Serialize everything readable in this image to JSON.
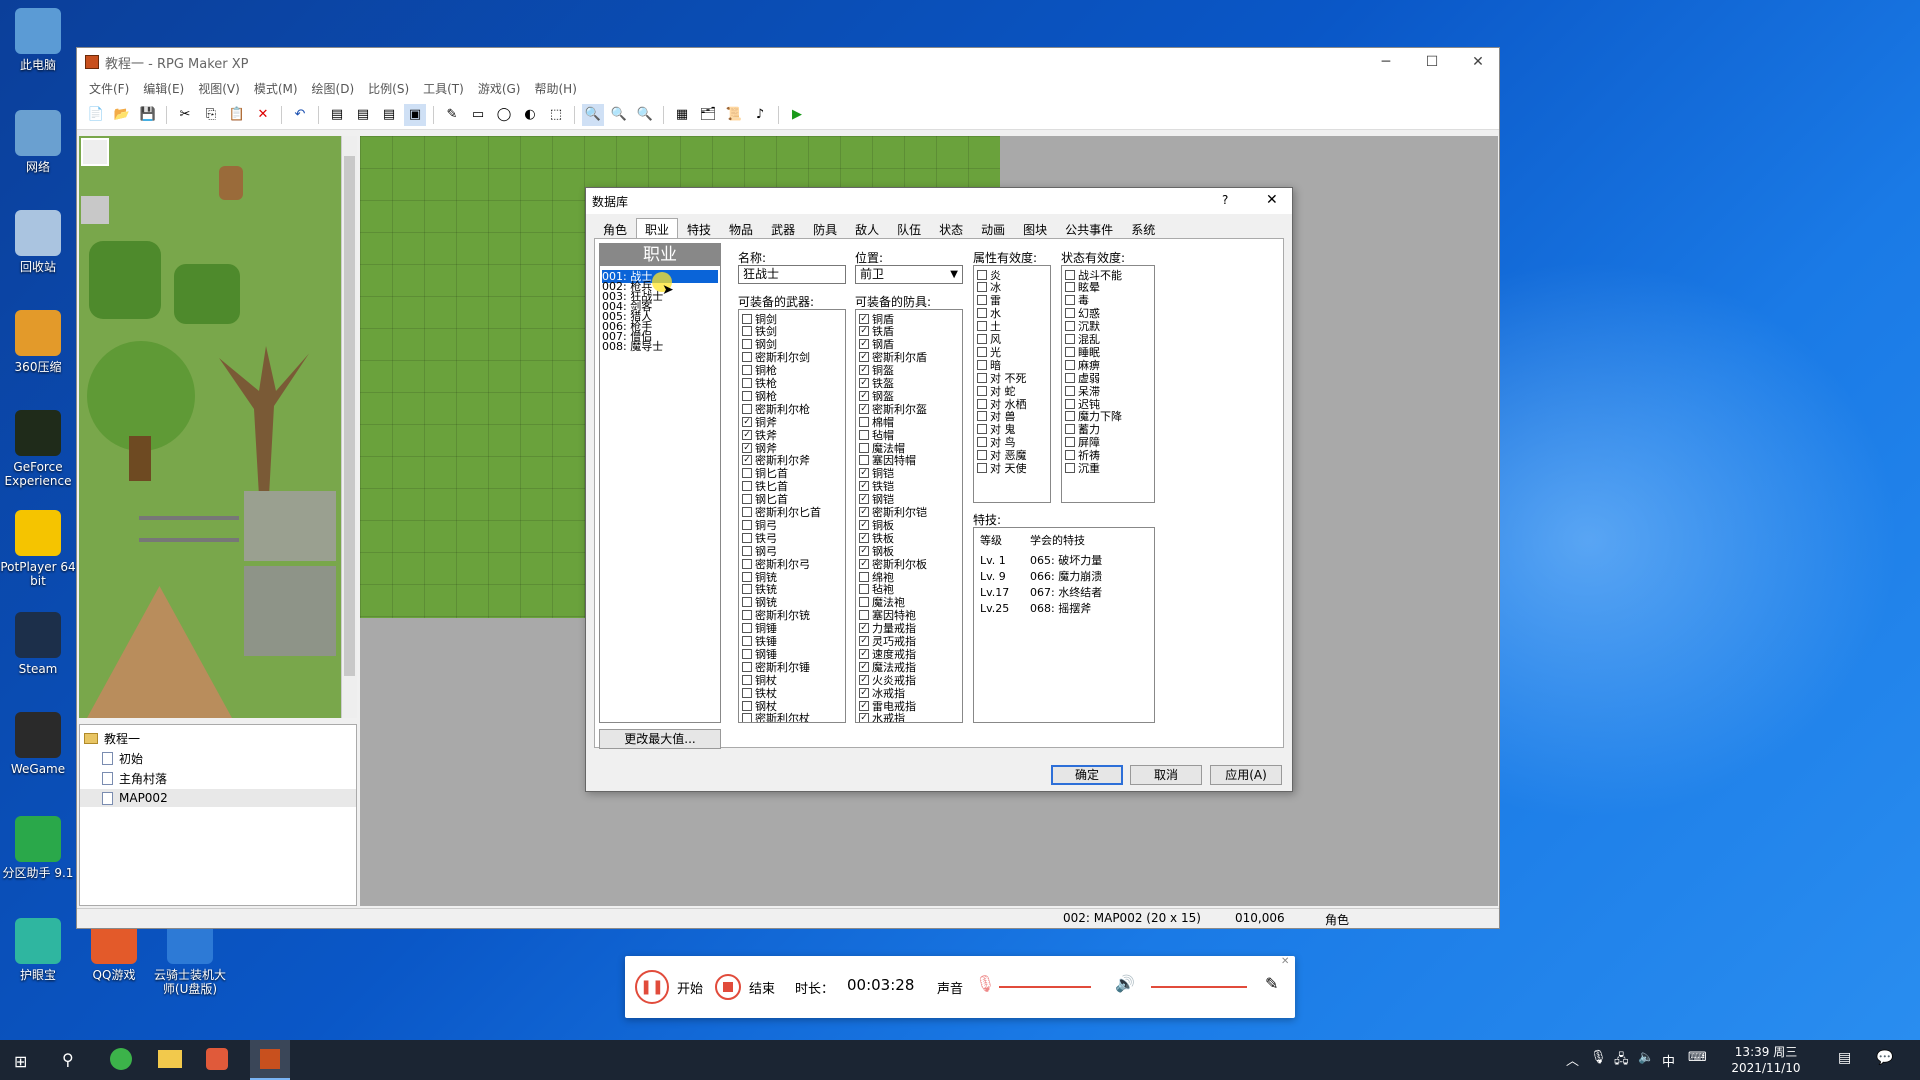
{
  "desktop": {
    "icons": [
      "此电脑",
      "网络",
      "回收站",
      "360压缩",
      "GeForce Experience",
      "PotPlayer 64 bit",
      "Steam",
      "WeGame",
      "分区助手 9.1",
      "护眼宝",
      "QQ游戏",
      "云骑士装机大师(U盘版)"
    ]
  },
  "window": {
    "title": "教程一 - RPG Maker XP",
    "menu": [
      "文件(F)",
      "编辑(E)",
      "视图(V)",
      "模式(M)",
      "绘图(D)",
      "比例(S)",
      "工具(T)",
      "游戏(G)",
      "帮助(H)"
    ],
    "controls": {
      "minimize": "─",
      "maximize": "☐",
      "close": "✕"
    }
  },
  "maptree": {
    "root": "教程一",
    "items": [
      "初始",
      "主角村落",
      "MAP002"
    ]
  },
  "status": {
    "map": "002: MAP002 (20 x 15)",
    "coords": "010,006",
    "mode": "角色"
  },
  "dialog": {
    "title": "数据库",
    "help": "?",
    "close": "✕",
    "tabs": [
      "角色",
      "职业",
      "特技",
      "物品",
      "武器",
      "防具",
      "敌人",
      "队伍",
      "状态",
      "动画",
      "图块",
      "公共事件",
      "系统"
    ],
    "active_tab": "职业",
    "list_header": "职业",
    "classes": [
      "001: 战士",
      "002: 枪兵",
      "003: 狂战士",
      "004: 剑客",
      "005: 猎人",
      "006: 枪手",
      "007: 僧侣",
      "008: 魔导士"
    ],
    "max_button": "更改最大值...",
    "name_label": "名称:",
    "name_value": "狂战士",
    "position_label": "位置:",
    "position_value": "前卫",
    "weapons_label": "可装备的武器:",
    "weapons": [
      {
        "t": "铜剑",
        "c": false
      },
      {
        "t": "铁剑",
        "c": false
      },
      {
        "t": "钢剑",
        "c": false
      },
      {
        "t": "密斯利尔剑",
        "c": false
      },
      {
        "t": "铜枪",
        "c": false
      },
      {
        "t": "铁枪",
        "c": false
      },
      {
        "t": "钢枪",
        "c": false
      },
      {
        "t": "密斯利尔枪",
        "c": false
      },
      {
        "t": "铜斧",
        "c": true
      },
      {
        "t": "铁斧",
        "c": true
      },
      {
        "t": "钢斧",
        "c": true
      },
      {
        "t": "密斯利尔斧",
        "c": true
      },
      {
        "t": "铜匕首",
        "c": false
      },
      {
        "t": "铁匕首",
        "c": false
      },
      {
        "t": "钢匕首",
        "c": false
      },
      {
        "t": "密斯利尔匕首",
        "c": false
      },
      {
        "t": "铜弓",
        "c": false
      },
      {
        "t": "铁弓",
        "c": false
      },
      {
        "t": "钢弓",
        "c": false
      },
      {
        "t": "密斯利尔弓",
        "c": false
      },
      {
        "t": "铜铳",
        "c": false
      },
      {
        "t": "铁铳",
        "c": false
      },
      {
        "t": "钢铳",
        "c": false
      },
      {
        "t": "密斯利尔铳",
        "c": false
      },
      {
        "t": "铜锤",
        "c": false
      },
      {
        "t": "铁锤",
        "c": false
      },
      {
        "t": "钢锤",
        "c": false
      },
      {
        "t": "密斯利尔锤",
        "c": false
      },
      {
        "t": "铜杖",
        "c": false
      },
      {
        "t": "铁杖",
        "c": false
      },
      {
        "t": "钢杖",
        "c": false
      },
      {
        "t": "密斯利尔杖",
        "c": false
      }
    ],
    "armors_label": "可装备的防具:",
    "armors": [
      {
        "t": "铜盾",
        "c": true
      },
      {
        "t": "铁盾",
        "c": true
      },
      {
        "t": "钢盾",
        "c": true
      },
      {
        "t": "密斯利尔盾",
        "c": true
      },
      {
        "t": "铜盔",
        "c": true
      },
      {
        "t": "铁盔",
        "c": true
      },
      {
        "t": "钢盔",
        "c": true
      },
      {
        "t": "密斯利尔盔",
        "c": true
      },
      {
        "t": "棉帽",
        "c": false
      },
      {
        "t": "毡帽",
        "c": false
      },
      {
        "t": "魔法帽",
        "c": false
      },
      {
        "t": "塞因特帽",
        "c": false
      },
      {
        "t": "铜铠",
        "c": true
      },
      {
        "t": "铁铠",
        "c": true
      },
      {
        "t": "钢铠",
        "c": true
      },
      {
        "t": "密斯利尔铠",
        "c": true
      },
      {
        "t": "铜板",
        "c": true
      },
      {
        "t": "铁板",
        "c": true
      },
      {
        "t": "钢板",
        "c": true
      },
      {
        "t": "密斯利尔板",
        "c": true
      },
      {
        "t": "绵袍",
        "c": false
      },
      {
        "t": "毡袍",
        "c": false
      },
      {
        "t": "魔法袍",
        "c": false
      },
      {
        "t": "塞因特袍",
        "c": false
      },
      {
        "t": "力量戒指",
        "c": true
      },
      {
        "t": "灵巧戒指",
        "c": true
      },
      {
        "t": "速度戒指",
        "c": true
      },
      {
        "t": "魔法戒指",
        "c": true
      },
      {
        "t": "火炎戒指",
        "c": true
      },
      {
        "t": "冰戒指",
        "c": true
      },
      {
        "t": "雷电戒指",
        "c": true
      },
      {
        "t": "水戒指",
        "c": true
      }
    ],
    "element_label": "属性有效度:",
    "elements": [
      "炎",
      "冰",
      "雷",
      "水",
      "土",
      "风",
      "光",
      "暗",
      "对 不死",
      "对 蛇",
      "对 水栖",
      "对 兽",
      "对 鬼",
      "对 鸟",
      "对 恶魔",
      "对 天使"
    ],
    "state_label": "状态有效度:",
    "states": [
      "战斗不能",
      "眩晕",
      "毒",
      "幻惑",
      "沉默",
      "混乱",
      "睡眠",
      "麻痹",
      "虚弱",
      "呆滞",
      "迟钝",
      "魔力下降",
      "蓄力",
      "屏障",
      "祈祷",
      "沉重"
    ],
    "skills_label": "特技:",
    "skills_header": {
      "level": "等级",
      "skill": "学会的特技"
    },
    "skills": [
      {
        "level": "Lv. 1",
        "skill": "065: 破坏力量"
      },
      {
        "level": "Lv. 9",
        "skill": "066: 魔力崩溃"
      },
      {
        "level": "Lv.17",
        "skill": "067: 水终结者"
      },
      {
        "level": "Lv.25",
        "skill": "068: 摇摆斧"
      }
    ],
    "buttons": {
      "ok": "确定",
      "cancel": "取消",
      "apply": "应用(A)"
    }
  },
  "recorder": {
    "start": "开始",
    "stop": "结束",
    "duration_label": "时长：",
    "duration": "00:03:28",
    "sound_label": "声音"
  },
  "taskbar": {
    "time": "13:39 周三",
    "date": "2021/11/10",
    "ime": "中"
  }
}
